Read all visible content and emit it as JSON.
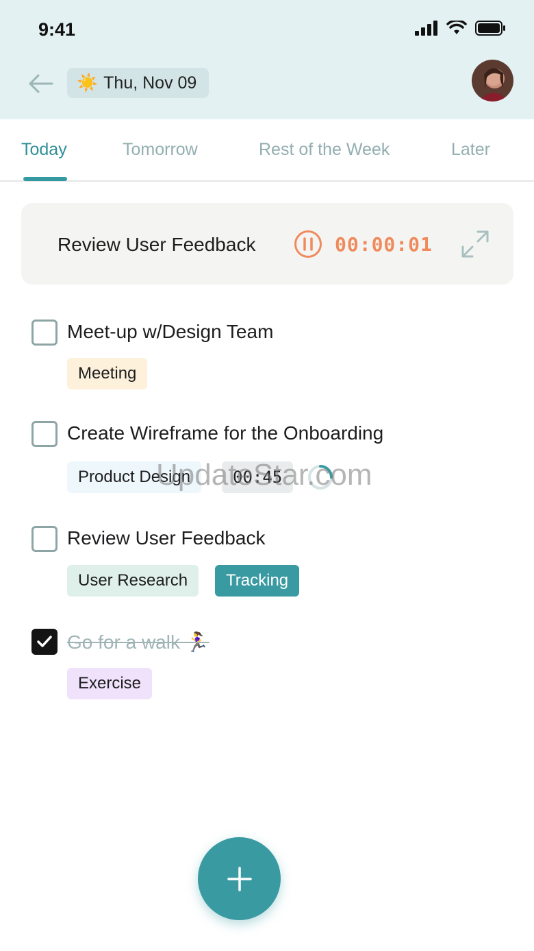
{
  "status_bar": {
    "time": "9:41"
  },
  "header": {
    "date_emoji": "☀️",
    "date": "Thu, Nov 09"
  },
  "tabs": [
    {
      "label": "Today",
      "active": true
    },
    {
      "label": "Tomorrow",
      "active": false
    },
    {
      "label": "Rest of the Week",
      "active": false
    },
    {
      "label": "Later",
      "active": false
    }
  ],
  "active_timer": {
    "task": "Review User Feedback",
    "elapsed": "00:00:01"
  },
  "tasks": [
    {
      "title": "Meet-up w/Design Team",
      "done": false,
      "tags": [
        "Meeting"
      ]
    },
    {
      "title": "Create Wireframe for the Onboarding",
      "done": false,
      "tags": [
        "Product Design"
      ],
      "time": "00:45"
    },
    {
      "title": "Review User Feedback",
      "done": false,
      "tags": [
        "User Research",
        "Tracking"
      ]
    },
    {
      "title": "Go for a walk 🏃‍♀️",
      "done": true,
      "tags": [
        "Exercise"
      ]
    }
  ],
  "watermark": "UpdateStar.com",
  "colors": {
    "accent": "#3a9aa2",
    "timer": "#f08a5d",
    "header_bg": "#e3f1f2"
  }
}
